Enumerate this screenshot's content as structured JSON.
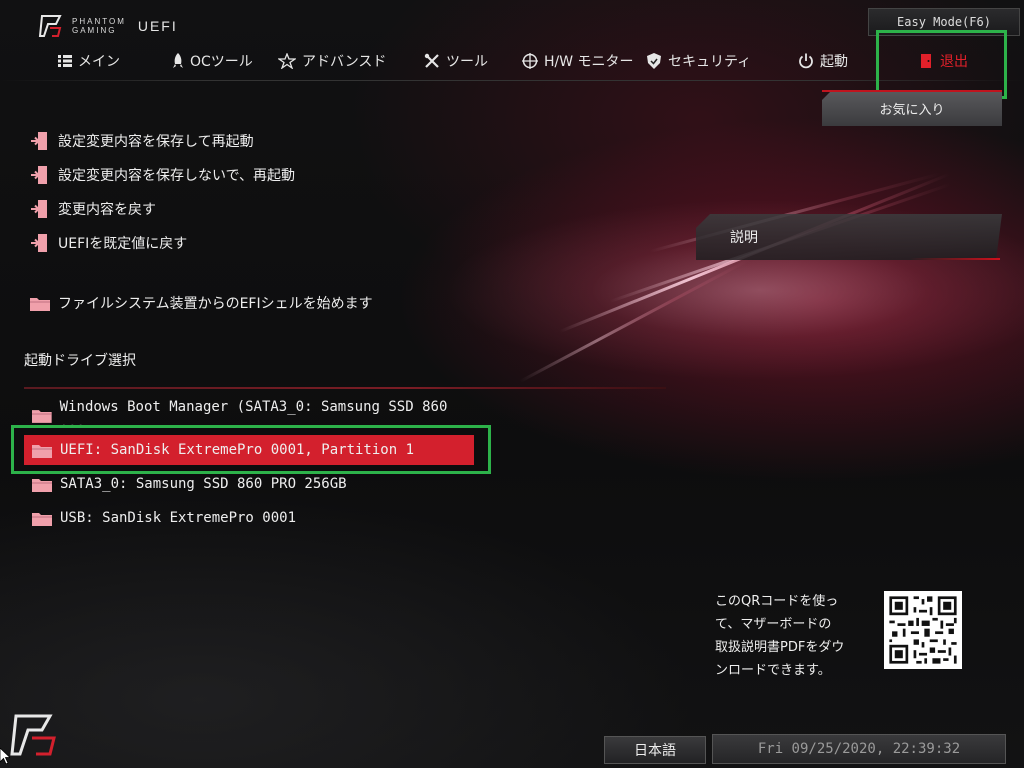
{
  "header": {
    "brand_line1": "PHANTOM",
    "brand_line2": "GAMING",
    "app_label": "UEFI",
    "easy_mode_label": "Easy Mode(F6)"
  },
  "nav": {
    "items": [
      {
        "label": "メイン",
        "icon": "list-icon"
      },
      {
        "label": "OCツール",
        "icon": "rocket-icon"
      },
      {
        "label": "アドバンスド",
        "icon": "star-icon"
      },
      {
        "label": "ツール",
        "icon": "tools-icon"
      },
      {
        "label": "H/W モニター",
        "icon": "target-icon"
      },
      {
        "label": "セキュリティ",
        "icon": "shield-icon"
      },
      {
        "label": "起動",
        "icon": "power-icon"
      },
      {
        "label": "退出",
        "icon": "exit-door-icon",
        "active": true
      }
    ]
  },
  "favorites_label": "お気に入り",
  "description_label": "説明",
  "exit_menu": [
    {
      "label": "設定変更内容を保存して再起動"
    },
    {
      "label": "設定変更内容を保存しないで、再起動"
    },
    {
      "label": "変更内容を戻す"
    },
    {
      "label": "UEFIを既定値に戻す"
    }
  ],
  "efi_shell_label": "ファイルシステム装置からのEFIシェルを始めます",
  "boot_override": {
    "title": "起動ドライブ選択",
    "items": [
      {
        "label": "Windows Boot Manager (SATA3_0: Samsung SSD 860 ..."
      },
      {
        "label": "UEFI: SanDisk ExtremePro 0001, Partition 1",
        "selected": true
      },
      {
        "label": "SATA3_0: Samsung SSD 860 PRO 256GB"
      },
      {
        "label": "USB: SanDisk ExtremePro 0001"
      }
    ]
  },
  "qr_caption": {
    "line1": "このQRコードを使っ",
    "line2": "て、マザーボードの",
    "line3": "取扱説明書PDFをダウ",
    "line4": "ンロードできます。"
  },
  "footer": {
    "language": "日本語",
    "datetime": "Fri 09/25/2020, 22:39:32"
  },
  "colors": {
    "accent": "#d3202d",
    "active_tab": "#e0202a",
    "highlight_box": "#2db24a",
    "icon_pink": "#f0a0ab"
  }
}
